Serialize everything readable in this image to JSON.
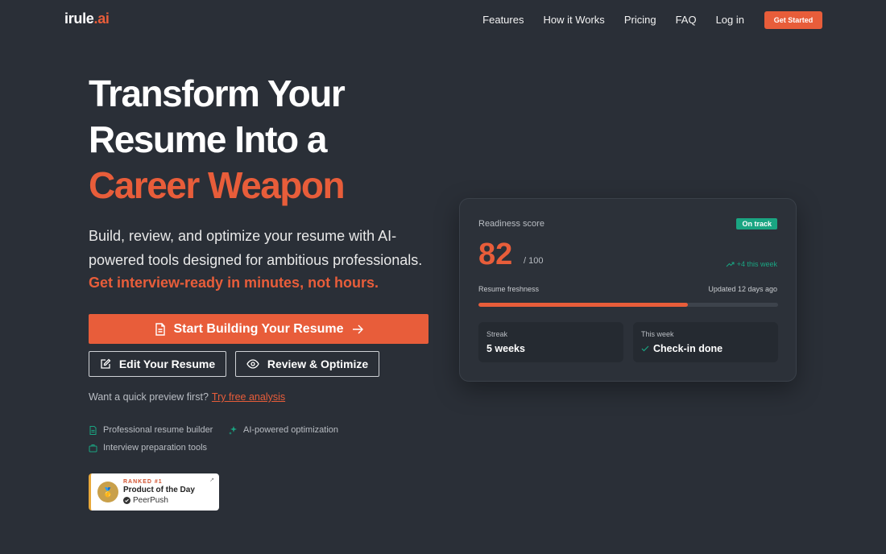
{
  "brand": {
    "name_prefix": "irule",
    "name_dot": ".ai"
  },
  "nav": {
    "links": [
      "Features",
      "How it Works",
      "Pricing",
      "FAQ",
      "Log in"
    ],
    "cta": "Get Started"
  },
  "hero": {
    "title_line1": "Transform Your",
    "title_line2": "Resume Into a",
    "title_accent": "Career Weapon",
    "subtitle": "Build, review, and optimize your resume with AI-powered tools designed for ambitious professionals.",
    "subtitle_accent": "Get interview-ready in minutes, not hours.",
    "primary_button": "Start Building Your Resume",
    "edit_button": "Edit Your Resume",
    "review_button": "Review & Optimize",
    "preview_text": "Want a quick preview first?",
    "preview_link": "Try free analysis",
    "features": [
      "Professional resume builder",
      "AI-powered optimization",
      "Interview preparation tools"
    ]
  },
  "badge": {
    "rank": "RANKED #1",
    "title": "Product of the Day",
    "source": "PeerPush"
  },
  "card": {
    "label": "Readiness score",
    "status_pill": "On track",
    "score": "82",
    "score_max": "/ 100",
    "delta": "+4 this week",
    "freshness_label": "Resume freshness",
    "freshness_updated": "Updated 12 days ago",
    "freshness_fraction": 0.7,
    "streak_label": "Streak",
    "streak_value": "5 weeks",
    "week_label": "This week",
    "week_value": "Check-in done"
  },
  "colors": {
    "accent": "#e85d3a",
    "success": "#1aa582",
    "background": "#2a2f37"
  }
}
